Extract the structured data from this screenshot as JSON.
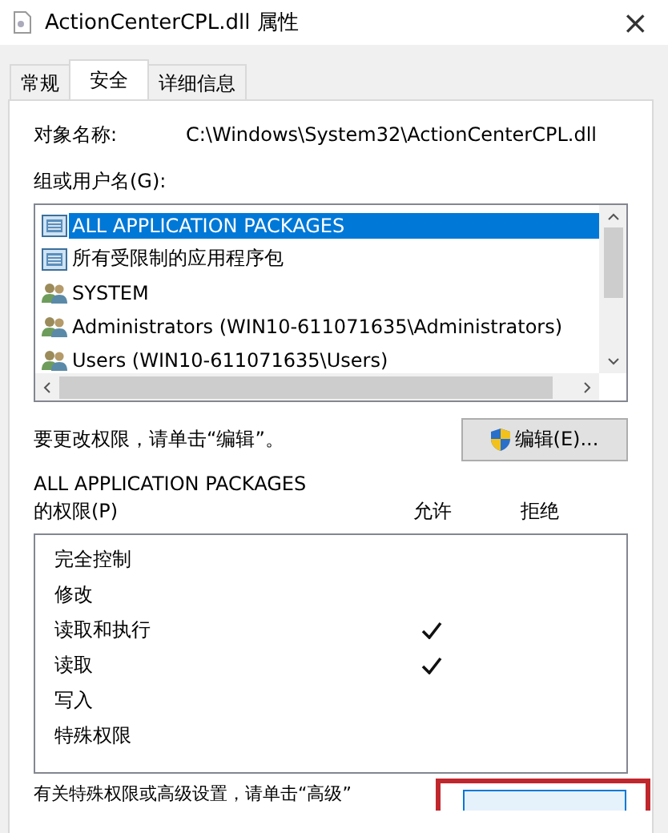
{
  "window": {
    "title": "ActionCenterCPL.dll 属性",
    "close": "×"
  },
  "tabs": [
    {
      "label": "常规",
      "selected": false
    },
    {
      "label": "安全",
      "selected": true
    },
    {
      "label": "详细信息",
      "selected": false
    }
  ],
  "object_name": {
    "label": "对象名称:",
    "value": "C:\\Windows\\System32\\ActionCenterCPL.dll"
  },
  "groups": {
    "label": "组或用户名(G):",
    "items": [
      {
        "name": "ALL APPLICATION PACKAGES",
        "kind": "package",
        "selected": true
      },
      {
        "name": "所有受限制的应用程序包",
        "kind": "package",
        "selected": false
      },
      {
        "name": "SYSTEM",
        "kind": "users",
        "selected": false
      },
      {
        "name": "Administrators (WIN10-611071635\\Administrators)",
        "kind": "users",
        "selected": false
      },
      {
        "name": "Users (WIN10-611071635\\Users)",
        "kind": "users",
        "selected": false
      }
    ]
  },
  "edit_hint": "要更改权限，请单击“编辑”。",
  "edit_button": "编辑(E)...",
  "permissions": {
    "title_line_1": "ALL APPLICATION PACKAGES",
    "title_line_2": "的权限(P)",
    "allow_label": "允许",
    "deny_label": "拒绝",
    "rows": [
      {
        "name": "完全控制",
        "allow": false,
        "deny": false
      },
      {
        "name": "修改",
        "allow": false,
        "deny": false
      },
      {
        "name": "读取和执行",
        "allow": true,
        "deny": false
      },
      {
        "name": "读取",
        "allow": true,
        "deny": false
      },
      {
        "name": "写入",
        "allow": false,
        "deny": false
      },
      {
        "name": "特殊权限",
        "allow": false,
        "deny": false
      }
    ]
  },
  "advanced_hint": "有关特殊权限或高级设置，请单击“高级”"
}
